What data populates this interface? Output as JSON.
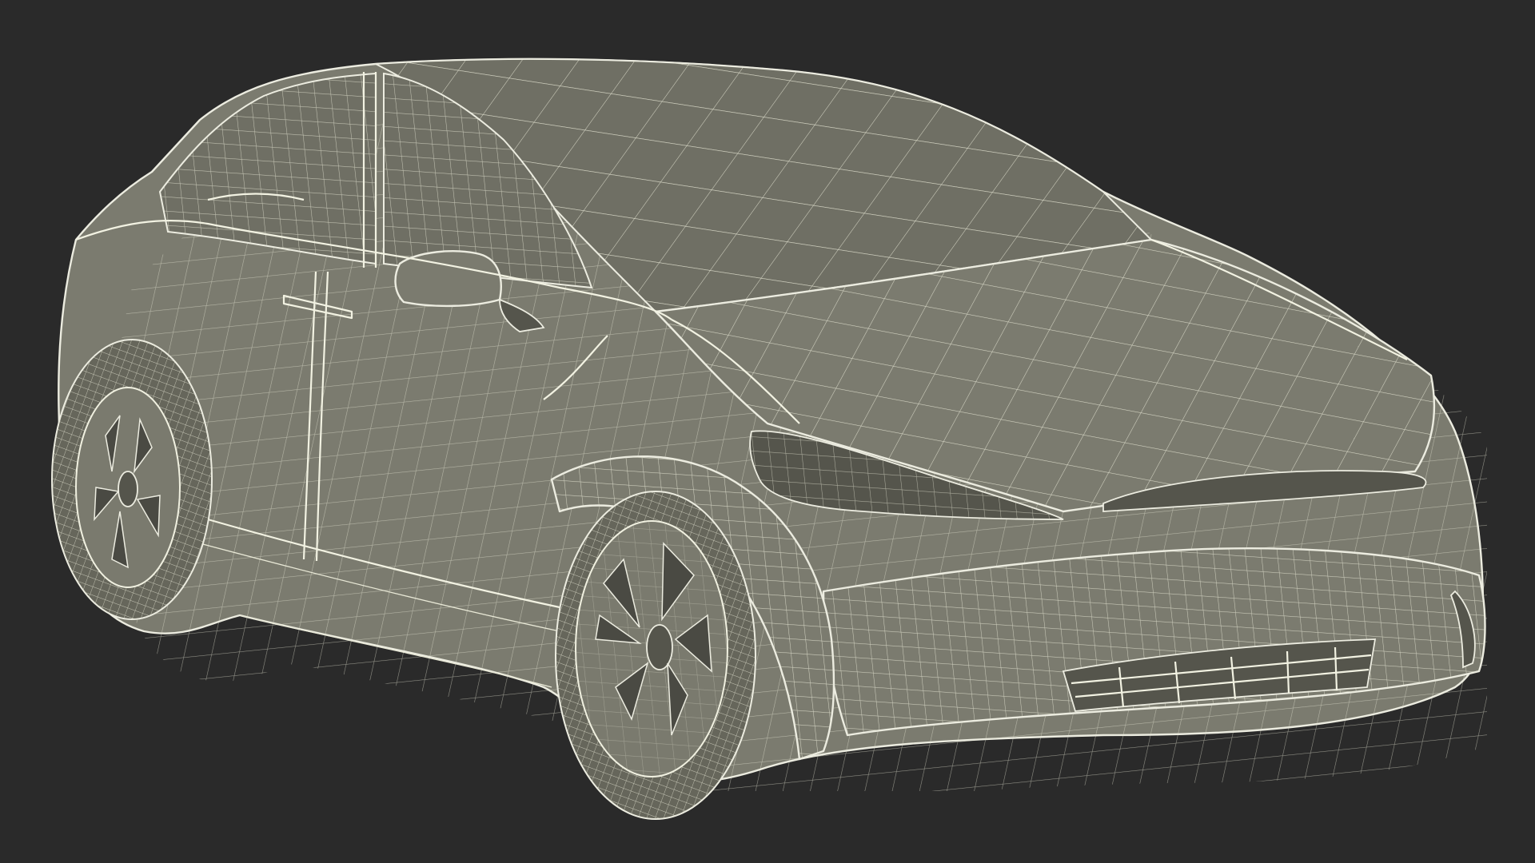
{
  "scene": {
    "subject": "wireframe-car-model",
    "colors": {
      "background": "#2a2a2a",
      "body": "#7b7b6f",
      "wireframe": "#ecece0"
    }
  }
}
